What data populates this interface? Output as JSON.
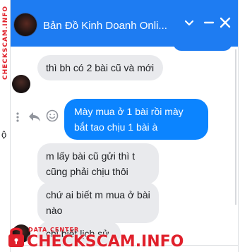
{
  "header": {
    "title": "Bản Đồ Kinh Doanh Onli...",
    "chevron_icon": "chevron-down-icon",
    "minimize_icon": "minimize-icon",
    "close_icon": "close-icon",
    "color": "#1e7cf2"
  },
  "background": {
    "letter": "ộ"
  },
  "messages": [
    {
      "side": "in",
      "text": "thì bh có 2 bài cũ và mới"
    },
    {
      "side": "out",
      "text": "Mày mua ở 1 bài rồi mày bắt tao chịu 1 bài à"
    },
    {
      "side": "in",
      "text": "m lấy bài cũ gửi thì t cũng phải chịu thôi"
    },
    {
      "side": "in",
      "text": "chứ ai biết m mua ở bài nào"
    },
    {
      "side": "in",
      "text": "chỉ biết lịch sử"
    }
  ],
  "watermark": {
    "vertical": "CHECKSCAM.INFO",
    "small": "DATA CENTER",
    "big": "CHECKSCAM.INFO"
  },
  "colors": {
    "outgoing": "#0b84ff",
    "incoming": "#e9eaed",
    "watermark": "#e0202b"
  }
}
